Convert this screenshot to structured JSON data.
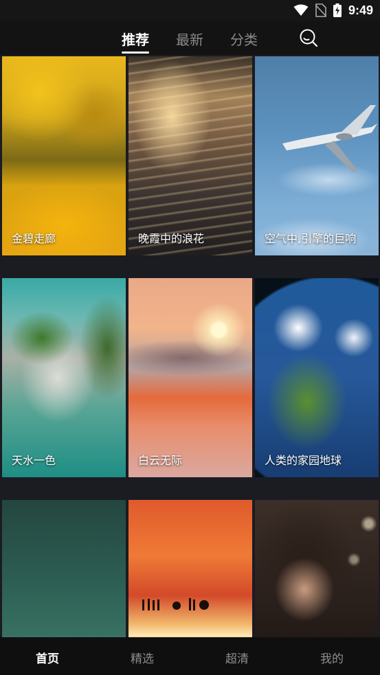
{
  "status_bar": {
    "time": "9:49"
  },
  "top_tabs": [
    "推荐",
    "最新",
    "分类"
  ],
  "cards": [
    {
      "title": "金碧走廊"
    },
    {
      "title": "晚霞中的浪花"
    },
    {
      "title": "空气中,引擎的巨响"
    },
    {
      "title": "天水一色"
    },
    {
      "title": "白云无际"
    },
    {
      "title": "人类的家园地球"
    },
    {
      "title": ""
    },
    {
      "title": ""
    },
    {
      "title": ""
    }
  ],
  "bottom_nav": [
    "首页",
    "精选",
    "超清",
    "我的"
  ],
  "colors": {
    "accent": "#ffffff",
    "inactive": "#8a8a8a",
    "background": "#0d0d0f"
  }
}
